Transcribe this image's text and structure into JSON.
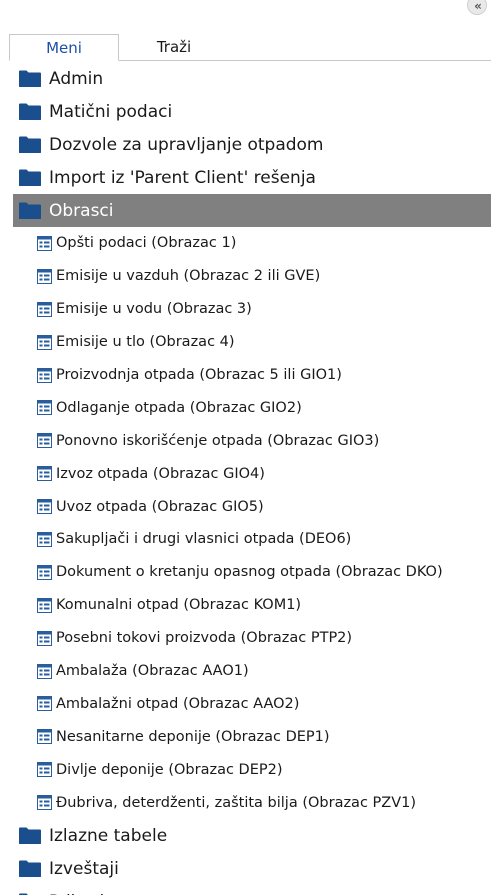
{
  "panel": {
    "collapse_glyph": "«"
  },
  "tabs": [
    {
      "label": "Meni",
      "active": true
    },
    {
      "label": "Traži",
      "active": false
    }
  ],
  "tree_top": [
    {
      "label": "Admin"
    },
    {
      "label": "Matični podaci"
    },
    {
      "label": "Dozvole za upravljanje otpadom"
    },
    {
      "label": "Import iz 'Parent Client' rešenja"
    },
    {
      "label": "Obrasci",
      "selected": true,
      "expanded": true
    }
  ],
  "obrasci_items": [
    "Opšti podaci (Obrazac 1)",
    "Emisije u vazduh (Obrazac 2 ili GVE)",
    "Emisije u vodu (Obrazac 3)",
    "Emisije u tlo (Obrazac 4)",
    "Proizvodnja otpada (Obrazac 5 ili GIO1)",
    "Odlaganje otpada (Obrazac GIO2)",
    "Ponovno iskorišćenje otpada (Obrazac GIO3)",
    "Izvoz otpada (Obrazac GIO4)",
    "Uvoz otpada (Obrazac GIO5)",
    "Sakupljači i drugi vlasnici otpada (DEO6)",
    "Dokument o kretanju opasnog otpada (Obrazac DKO)",
    "Komunalni otpad (Obrazac KOM1)",
    "Posebni tokovi proizvoda (Obrazac PTP2)",
    "Ambalaža (Obrazac AAO1)",
    "Ambalažni otpad (Obrazac AAO2)",
    "Nesanitarne deponije (Obrazac DEP1)",
    "Divlje deponije (Obrazac DEP2)",
    "Đubriva, deterdženti, zaštita bilja (Obrazac PZV1)"
  ],
  "tree_bottom": [
    {
      "label": "Izlazne tabele"
    },
    {
      "label": "Izveštaji"
    },
    {
      "label": "Prikazi"
    }
  ],
  "colors": {
    "folder": "#1b4e8c",
    "selected_bg": "#808080",
    "active_tab_text": "#1e4fa8"
  },
  "icons": {
    "folder": "folder-icon",
    "form": "form-icon",
    "collapse": "collapse-left-icon"
  }
}
